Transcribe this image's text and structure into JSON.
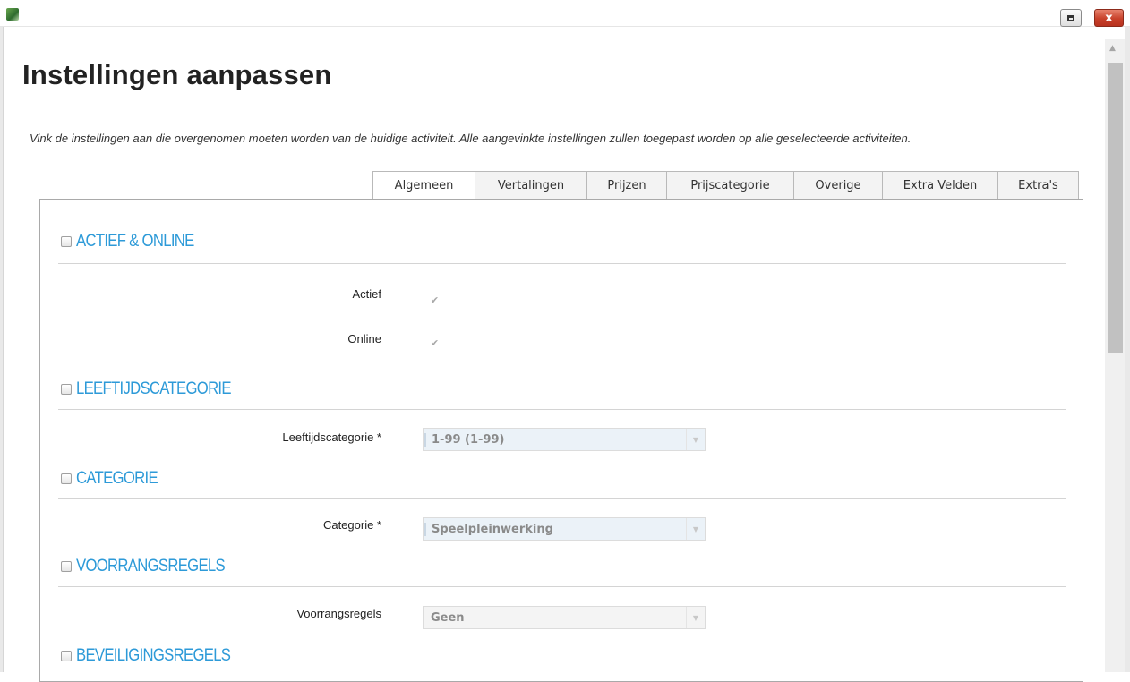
{
  "window": {
    "close_label": "x"
  },
  "page": {
    "title": "Instellingen aanpassen",
    "intro": "Vink de instellingen aan die overgenomen moeten worden van de huidige activiteit. Alle aangevinkte instellingen zullen toegepast worden op alle geselecteerde activiteiten."
  },
  "tabs": [
    {
      "label": "Algemeen",
      "active": true
    },
    {
      "label": "Vertalingen"
    },
    {
      "label": "Prijzen"
    },
    {
      "label": "Prijscategorie"
    },
    {
      "label": "Overige"
    },
    {
      "label": "Extra Velden"
    },
    {
      "label": "Extra's"
    }
  ],
  "sections": {
    "actief_online": {
      "title": "ACTIEF & ONLINE",
      "fields": {
        "actief_label": "Actief",
        "actief_checked": true,
        "online_label": "Online",
        "online_checked": true
      }
    },
    "leeftijd": {
      "title": "LEEFTIJDSCATEGORIE",
      "label": "Leeftijdscategorie *",
      "value": "1-99 (1-99)"
    },
    "categorie": {
      "title": "CATEGORIE",
      "label": "Categorie *",
      "value": "Speelpleinwerking"
    },
    "voorrang": {
      "title": "VOORRANGSREGELS",
      "label": "Voorrangsregels",
      "value": "Geen"
    },
    "beveiliging": {
      "title": "BEVEILIGINGSREGELS"
    }
  },
  "colors": {
    "accent": "#2d9ad8",
    "close": "#c8412a"
  }
}
